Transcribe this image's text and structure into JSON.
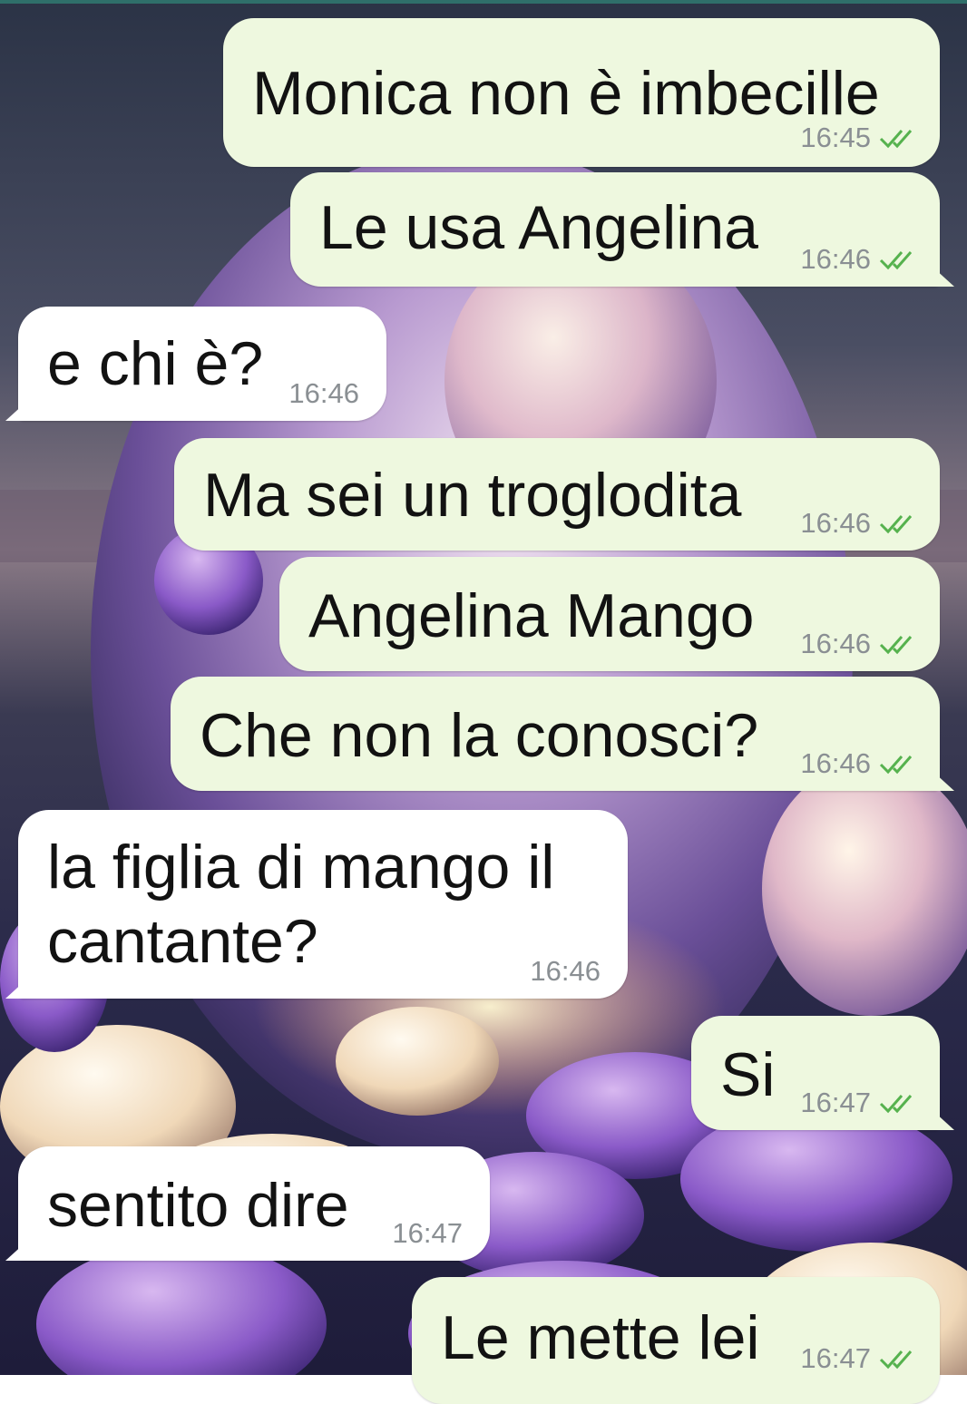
{
  "colors": {
    "outgoing_bubble": "#eef8df",
    "incoming_bubble": "#ffffff",
    "timestamp": "#8a8f93",
    "read_tick": "#56b24e"
  },
  "messages": [
    {
      "direction": "out",
      "text": "Monica non è imbecille",
      "time": "16:45",
      "status_icon": "double-check-icon"
    },
    {
      "direction": "out",
      "text": "Le usa Angelina",
      "time": "16:46",
      "status_icon": "double-check-icon"
    },
    {
      "direction": "in",
      "text": "e chi è?",
      "time": "16:46"
    },
    {
      "direction": "out",
      "text": "Ma sei un troglodita",
      "time": "16:46",
      "status_icon": "double-check-icon"
    },
    {
      "direction": "out",
      "text": "Angelina Mango",
      "time": "16:46",
      "status_icon": "double-check-icon"
    },
    {
      "direction": "out",
      "text": "Che non la conosci?",
      "time": "16:46",
      "status_icon": "double-check-icon"
    },
    {
      "direction": "in",
      "text": "la figlia di mango il cantante?",
      "time": "16:46"
    },
    {
      "direction": "out",
      "text": "Si",
      "time": "16:47",
      "status_icon": "double-check-icon"
    },
    {
      "direction": "in",
      "text": "sentito dire",
      "time": "16:47"
    },
    {
      "direction": "out",
      "text": "Le mette lei",
      "time": "16:47",
      "status_icon": "double-check-icon"
    }
  ]
}
